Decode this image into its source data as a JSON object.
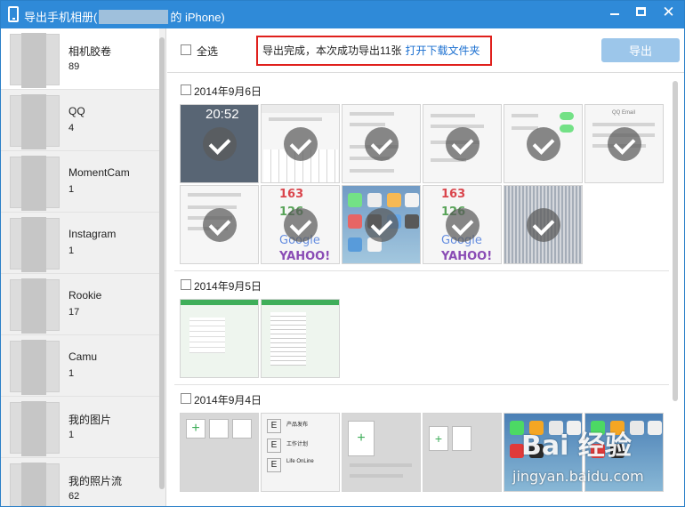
{
  "window": {
    "title_prefix": "导出手机相册(",
    "title_suffix": "的 iPhone)"
  },
  "sidebar": {
    "items": [
      {
        "name": "相机胶卷",
        "count": "89",
        "active": true
      },
      {
        "name": "QQ",
        "count": "4"
      },
      {
        "name": "MomentCam",
        "count": "1"
      },
      {
        "name": "Instagram",
        "count": "1"
      },
      {
        "name": "Rookie",
        "count": "17"
      },
      {
        "name": "Camu",
        "count": "1"
      },
      {
        "name": "我的图片",
        "count": "1"
      },
      {
        "name": "我的照片流",
        "count": "62"
      }
    ]
  },
  "toolbar": {
    "select_all": "全选",
    "notice_text": "导出完成，本次成功导出11张",
    "notice_link": "打开下载文件夹",
    "export_button": "导出"
  },
  "groups": [
    {
      "date": "2014年9月6日"
    },
    {
      "date": "2014年9月5日"
    },
    {
      "date": "2014年9月4日"
    }
  ],
  "thumb_text": {
    "lock_time": "20:52",
    "logo_163": "163",
    "logo_126": "126",
    "logo_google": "Google",
    "logo_yahoo": "YAHOO!",
    "qq_email": "QQ Email",
    "product_release": "产品发布",
    "work_plan": "工作计划",
    "life_online": "Life OnLine"
  },
  "watermark": {
    "main": "Bai 经验",
    "sub": "jingyan.baidu.com"
  },
  "colors": {
    "titlebar": "#2f8ad8",
    "notice_border": "#e0201c",
    "link": "#1a6fd0",
    "export_button": "#9cc6ea"
  }
}
